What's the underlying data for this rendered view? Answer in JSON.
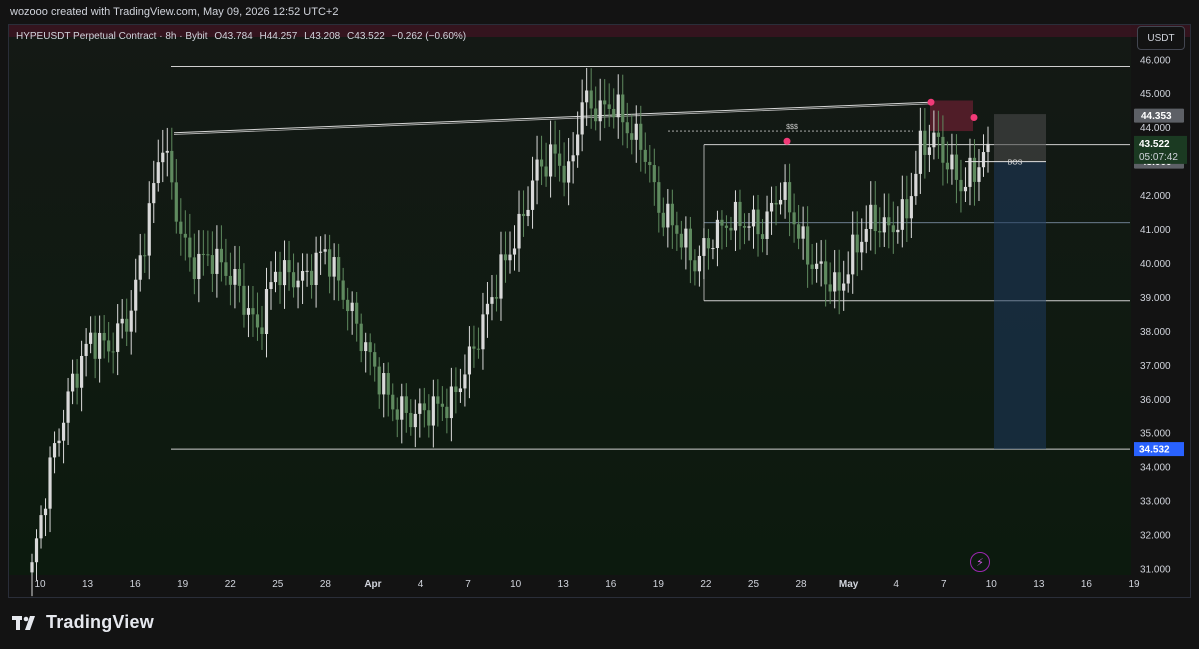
{
  "header": {
    "credit": "wozooo created with TradingView.com, May 09, 2026 12:52 UTC+2"
  },
  "legend": {
    "symbol": "HYPEUSDT Perpetual Contract · 8h · Bybit",
    "open": "O43.784",
    "high": "H44.257",
    "low": "L43.208",
    "close": "C43.522",
    "change": "−0.262 (−0.60%)"
  },
  "currency_button": "USDT",
  "brand": "TradingView",
  "colors": {
    "background": "#131313",
    "up_candle": "#d9d9d9",
    "down_candle": "#5f8a5f",
    "price_label_bg": "#1b3a22",
    "target_label_bg": "#2962ff",
    "marker": "#f23a78",
    "supply_zone": "#5c1f2b"
  },
  "chart_data": {
    "type": "candlestick",
    "timeframe": "8h",
    "ylim": [
      31,
      46.7
    ],
    "yticks": [
      "31.000",
      "32.000",
      "33.000",
      "34.000",
      "35.000",
      "36.000",
      "37.000",
      "38.000",
      "39.000",
      "40.000",
      "41.000",
      "42.000",
      "43.000",
      "44.000",
      "45.000",
      "46.000"
    ],
    "xticks": [
      "10",
      "13",
      "16",
      "19",
      "22",
      "25",
      "28",
      "Apr",
      "4",
      "7",
      "10",
      "13",
      "16",
      "19",
      "22",
      "25",
      "28",
      "May",
      "4",
      "7",
      "10",
      "13",
      "16",
      "19"
    ],
    "bold_ticks": [
      "Apr",
      "May"
    ],
    "price_labels": {
      "last": "43.522",
      "countdown": "05:07:42",
      "upper": "44.353",
      "lower": "43.000",
      "target": "34.532"
    },
    "levels": {
      "top": 45.8,
      "range_high": 43.5,
      "range_mid": 41.2,
      "range_low": 38.9,
      "target": 34.532,
      "bos": 43.0,
      "liquidity": 43.9
    },
    "annotations": {
      "liquidity_label": "$$$",
      "bos_label": "BOS"
    },
    "anchor_points": [
      [
        0,
        31.0
      ],
      [
        4,
        34.0
      ],
      [
        9,
        36.5
      ],
      [
        13,
        37.8
      ],
      [
        17,
        37.5
      ],
      [
        22,
        38.6
      ],
      [
        26,
        41.5
      ],
      [
        29,
        43.7
      ],
      [
        32,
        41.5
      ],
      [
        35,
        40.0
      ],
      [
        40,
        40.2
      ],
      [
        45,
        39.5
      ],
      [
        50,
        38.0
      ],
      [
        54,
        39.8
      ],
      [
        60,
        39.5
      ],
      [
        65,
        40.4
      ],
      [
        70,
        38.8
      ],
      [
        75,
        37.2
      ],
      [
        80,
        35.8
      ],
      [
        84,
        35.5
      ],
      [
        88,
        35.7
      ],
      [
        93,
        35.9
      ],
      [
        98,
        37.5
      ],
      [
        104,
        39.8
      ],
      [
        108,
        41.0
      ],
      [
        112,
        42.8
      ],
      [
        116,
        43.2
      ],
      [
        119,
        42.5
      ],
      [
        122,
        44.8
      ],
      [
        126,
        44.5
      ],
      [
        129,
        44.7
      ],
      [
        132,
        44.0
      ],
      [
        136,
        43.3
      ],
      [
        139,
        41.6
      ],
      [
        143,
        41.0
      ],
      [
        147,
        40.0
      ],
      [
        151,
        40.8
      ],
      [
        155,
        41.3
      ],
      [
        159,
        41.2
      ],
      [
        162,
        41.0
      ],
      [
        166,
        42.2
      ],
      [
        169,
        41.3
      ],
      [
        172,
        40.2
      ],
      [
        176,
        39.6
      ],
      [
        179,
        39.2
      ],
      [
        182,
        40.3
      ],
      [
        186,
        41.3
      ],
      [
        190,
        41.0
      ],
      [
        194,
        41.5
      ],
      [
        197,
        43.4
      ],
      [
        200,
        43.7
      ],
      [
        203,
        43.0
      ],
      [
        206,
        42.3
      ],
      [
        209,
        42.7
      ],
      [
        212,
        43.522
      ]
    ]
  }
}
